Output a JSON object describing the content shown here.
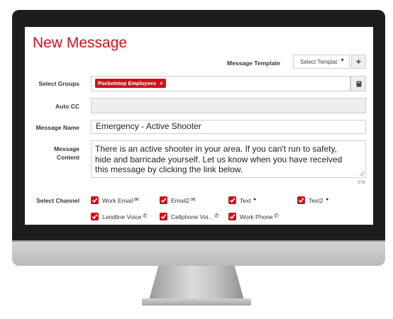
{
  "page": {
    "title": "New Message"
  },
  "template": {
    "label": "Message Template",
    "select_value": "Select Templat",
    "add_symbol": "+"
  },
  "groups": {
    "label": "Select Groups",
    "tag": "Pocketstop Employees",
    "tag_remove": "×"
  },
  "auto_cc": {
    "label": "Auto CC",
    "value": ""
  },
  "name": {
    "label": "Message Name",
    "value": "Emergency - Active Shooter"
  },
  "content": {
    "label_line1": "Message",
    "label_line2": "Content",
    "value": "There is an active shooter in your area. If you can't run to safety, hide and barricade yourself. Let us know when you have received this message by clicking the link below.",
    "char_count": "576"
  },
  "channel": {
    "label": "Select Channel",
    "items": [
      {
        "label": "Work Email",
        "icon": "envelope-icon",
        "glyph": "✉"
      },
      {
        "label": "Email2",
        "icon": "envelope-icon",
        "glyph": "✉"
      },
      {
        "label": "Text",
        "icon": "chat-bubble-icon",
        "glyph": "●"
      },
      {
        "label": "Text2",
        "icon": "chat-bubble-icon",
        "glyph": "●"
      },
      {
        "label": "Landline Voice",
        "icon": "phone-icon",
        "glyph": "✆"
      },
      {
        "label": "Cellphone Voi...",
        "icon": "phone-icon",
        "glyph": "✆"
      },
      {
        "label": "Work Phone",
        "icon": "phone-icon",
        "glyph": "✆"
      }
    ]
  },
  "colors": {
    "accent": "#d0111b",
    "bezel": "#1d1d1d"
  }
}
